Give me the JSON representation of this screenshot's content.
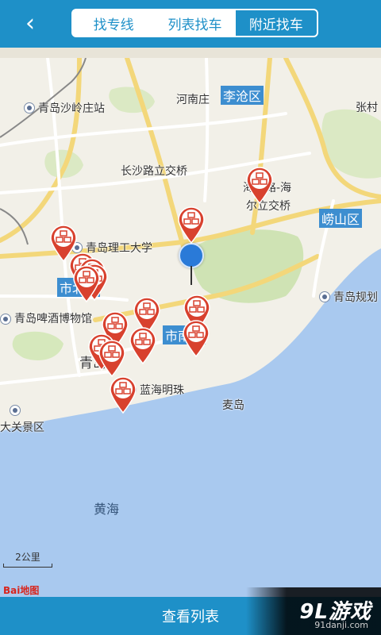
{
  "header": {
    "back_icon": "chevron-left-icon",
    "tabs": [
      {
        "label": "找专线",
        "active": false
      },
      {
        "label": "列表找车",
        "active": false
      },
      {
        "label": "附近找车",
        "active": true
      }
    ]
  },
  "map": {
    "labels": {
      "shaling_station": "青岛沙岭庄站",
      "henanzhuang": "河南庄",
      "licang": "李沧区",
      "zhangcun": "张村",
      "changshalu": "长沙路立交桥",
      "haier_line1": "海尔路-海",
      "haier_line2": "尔立交桥",
      "laoshan": "崂山区",
      "ligong": "青岛理工大学",
      "shibei": "市北区",
      "beer_museum": "青岛啤酒博物馆",
      "shinan": "市南区",
      "qingdao_city": "青岛市",
      "guihua": "青岛规划",
      "lanhai": "蓝海明珠",
      "maidao": "麦岛",
      "daguan": "大关景区",
      "yellow_sea": "黄海"
    },
    "scale_label": "2公里",
    "logo_text": "Bai",
    "logo_text2": "地图",
    "markers_count": 15
  },
  "bottom": {
    "view_list_label": "查看列表"
  },
  "watermark": {
    "main": "9L游戏",
    "sub": "91danji.com"
  },
  "colors": {
    "accent": "#1e90c8",
    "marker": "#d8412e",
    "sea": "#a8c8f0"
  }
}
